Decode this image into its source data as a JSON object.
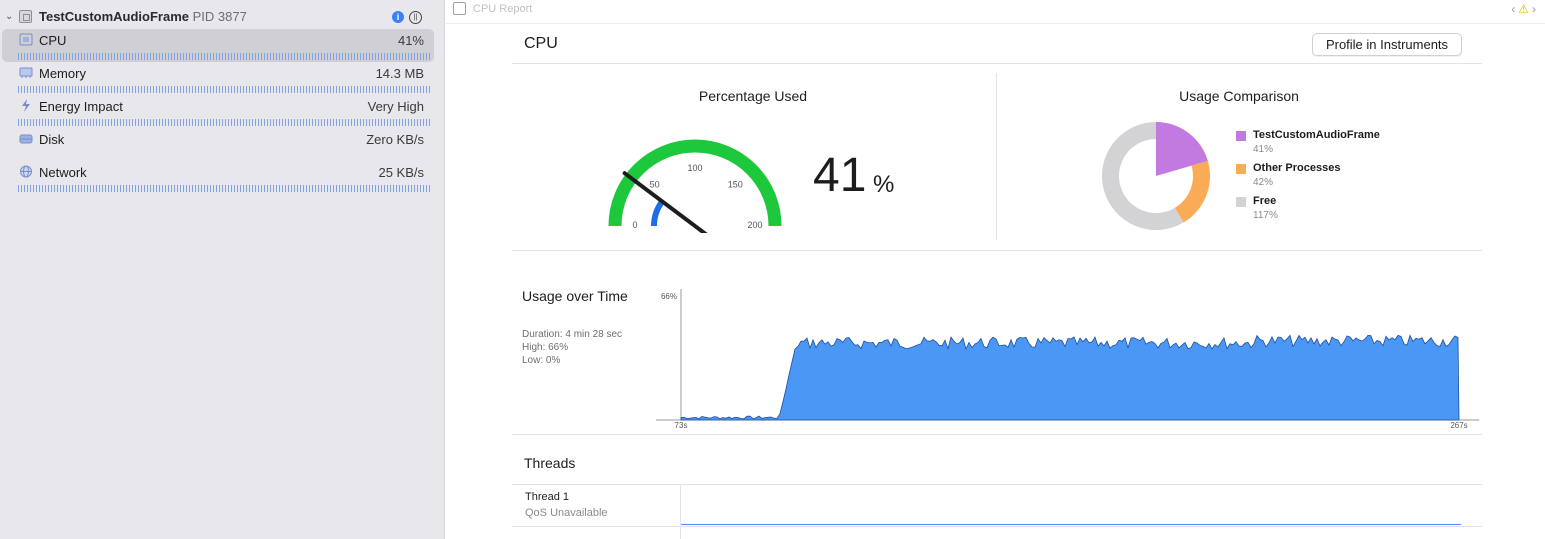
{
  "sidebar": {
    "process": {
      "name": "TestCustomAudioFrame",
      "pid": "PID 3877"
    },
    "gauges": [
      {
        "label": "CPU",
        "value": "41%",
        "icon": "cpu-icon",
        "selected": true
      },
      {
        "label": "Memory",
        "value": "14.3 MB",
        "icon": "memory-icon",
        "selected": false
      },
      {
        "label": "Energy Impact",
        "value": "Very High",
        "icon": "bolt-icon",
        "selected": false
      },
      {
        "label": "Disk",
        "value": "Zero KB/s",
        "icon": "disk-icon",
        "selected": false
      },
      {
        "label": "Network",
        "value": "25 KB/s",
        "icon": "globe-icon",
        "selected": false
      }
    ]
  },
  "main": {
    "report_title": "CPU Report",
    "section_title": "CPU",
    "profile_button": "Profile in Instruments",
    "percentage_used": {
      "title": "Percentage Used",
      "value": "41",
      "unit": "%",
      "gauge_ticks": [
        "0",
        "50",
        "100",
        "150",
        "200"
      ],
      "gauge_value": 41,
      "gauge_max": 200
    },
    "usage_comparison": {
      "title": "Usage Comparison",
      "items": [
        {
          "name": "TestCustomAudioFrame",
          "value": "41%",
          "color": "#c27ae0",
          "amount": 41
        },
        {
          "name": "Other Processes",
          "value": "42%",
          "color": "#f9ab55",
          "amount": 42
        },
        {
          "name": "Free",
          "value": "117%",
          "color": "#d3d3d5",
          "amount": 117
        }
      ]
    },
    "usage_over_time": {
      "title": "Usage over Time",
      "duration": "Duration: 4 min 28 sec",
      "high": "High: 66%",
      "low": "Low: 0%",
      "y_max_label": "66%",
      "x_start_label": "73s",
      "x_end_label": "267s"
    },
    "threads": {
      "title": "Threads",
      "items": [
        {
          "name": "Thread 1",
          "qos": "QoS Unavailable"
        }
      ]
    }
  },
  "colors": {
    "gauge_green": "#1ec83c",
    "gauge_blue": "#1e6fe6",
    "chart_fill": "#4b97f5",
    "chart_line": "#1f4f9a"
  }
}
